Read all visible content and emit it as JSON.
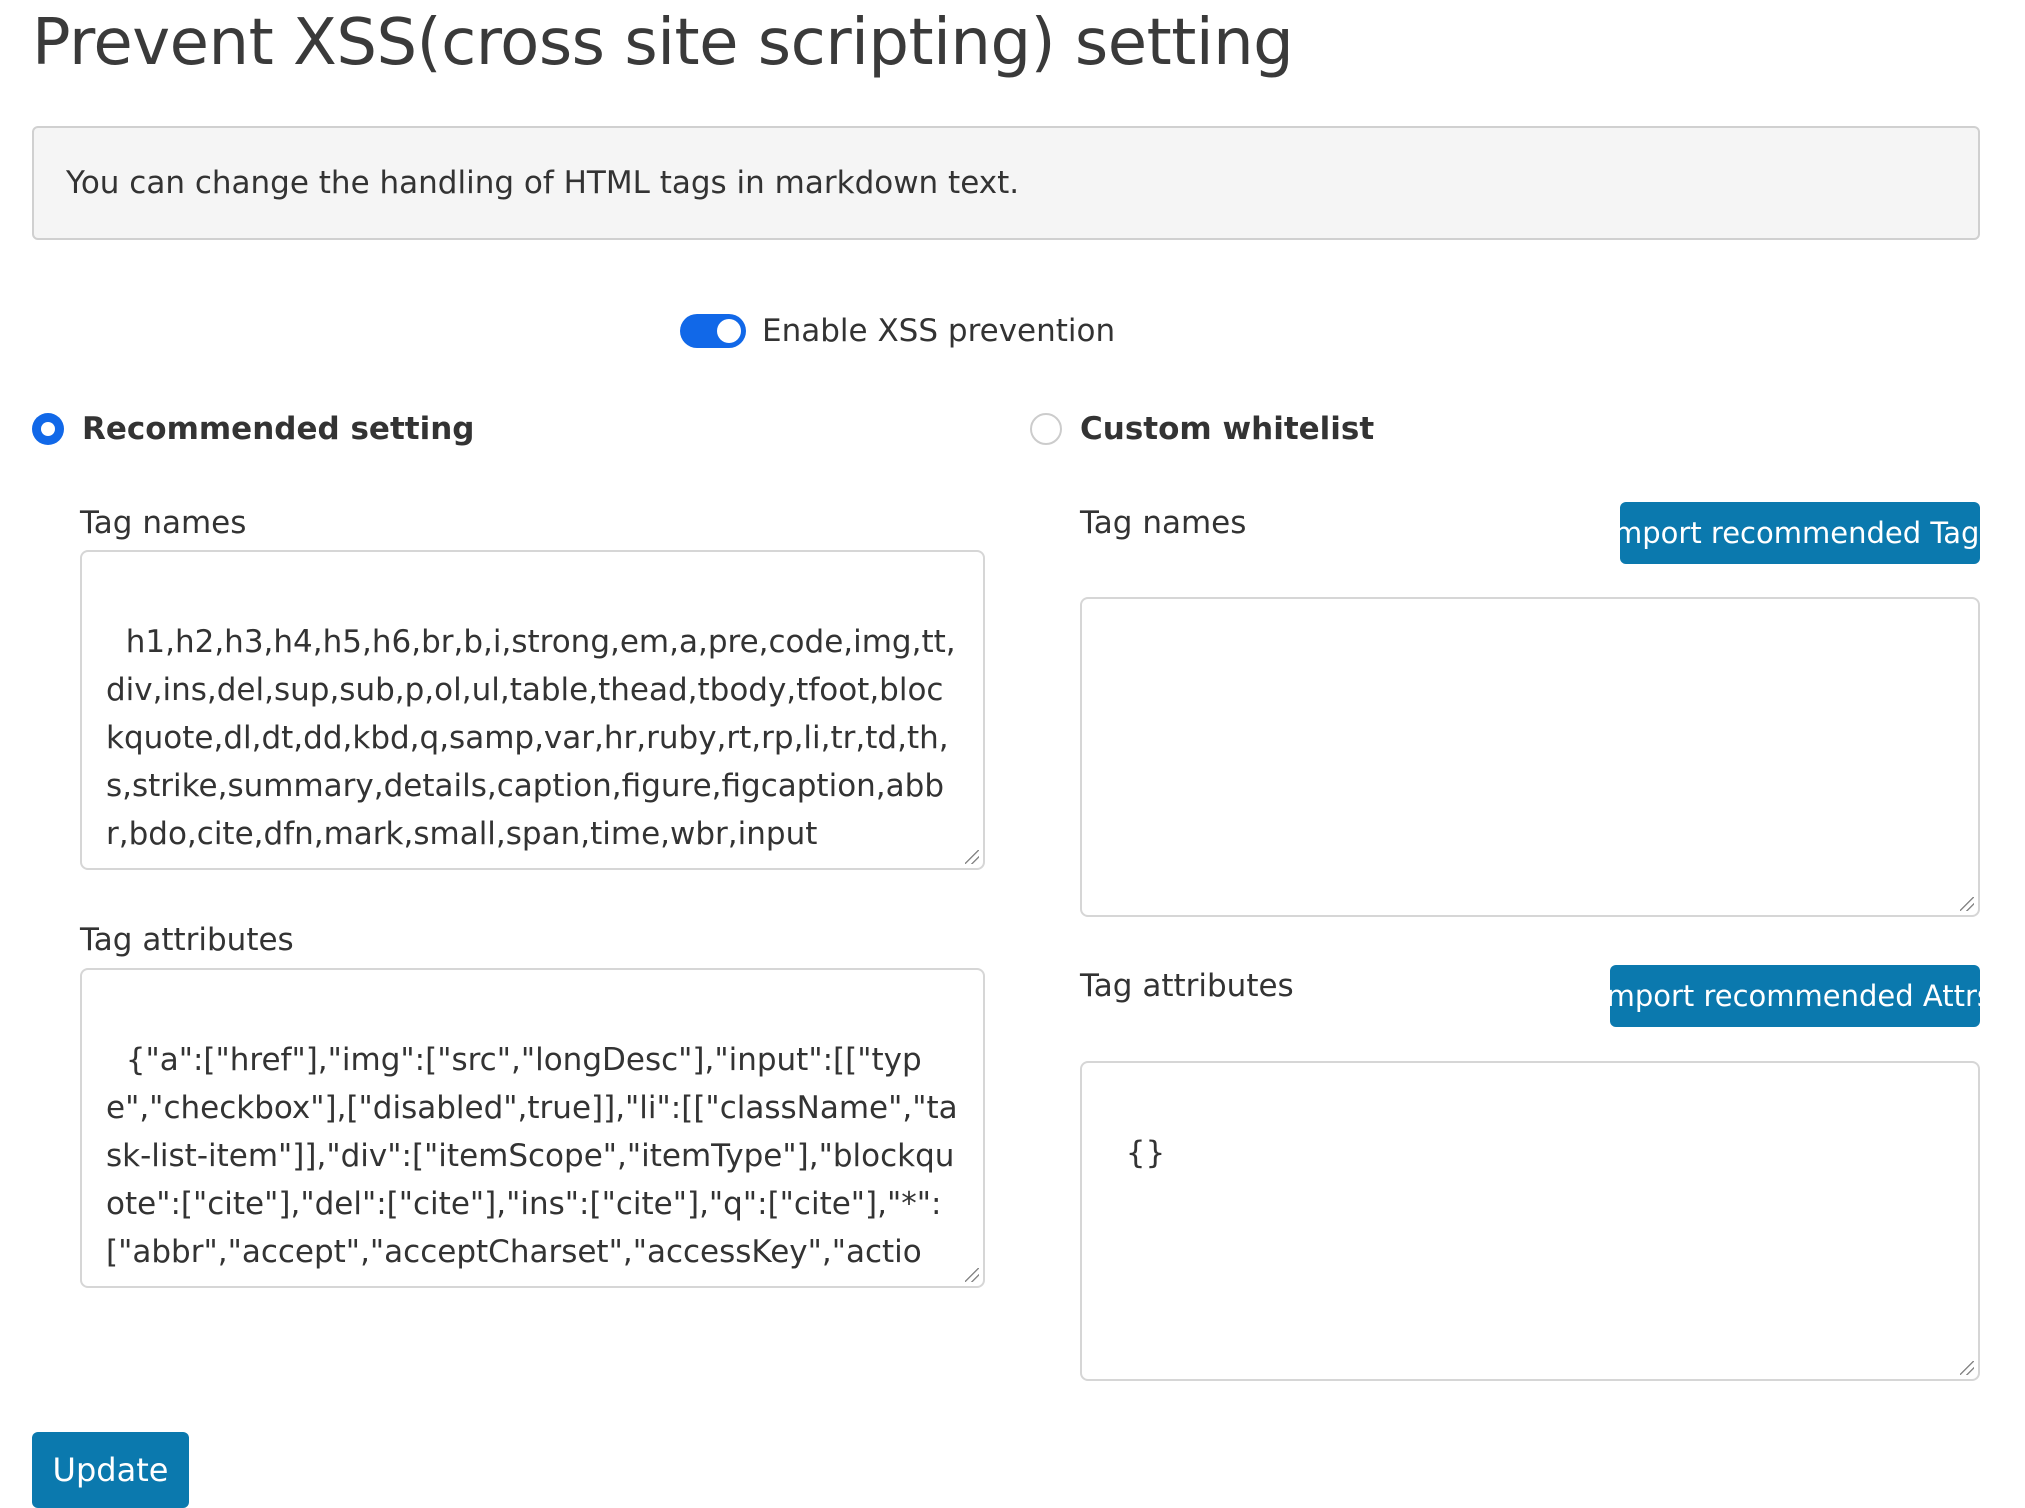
{
  "page": {
    "title": "Prevent XSS(cross site scripting) setting",
    "description": "You can change the handling of HTML tags in markdown text."
  },
  "toggle": {
    "label": "Enable XSS prevention",
    "enabled": true
  },
  "recommended": {
    "radio_label": "Recommended setting",
    "selected": true,
    "tag_names_label": "Tag names",
    "tag_names_value": "h1,h2,h3,h4,h5,h6,br,b,i,strong,em,a,pre,code,img,tt,div,ins,del,sup,sub,p,ol,ul,table,thead,tbody,tfoot,blockquote,dl,dt,dd,kbd,q,samp,var,hr,ruby,rt,rp,li,tr,td,th,s,strike,summary,details,caption,figure,figcaption,abbr,bdo,cite,dfn,mark,small,span,time,wbr,input",
    "tag_attributes_label": "Tag attributes",
    "tag_attributes_value": "{\"a\":[\"href\"],\"img\":[\"src\",\"longDesc\"],\"input\":[[\"type\",\"checkbox\"],[\"disabled\",true]],\"li\":[[\"className\",\"task-list-item\"]],\"div\":[\"itemScope\",\"itemType\"],\"blockquote\":[\"cite\"],\"del\":[\"cite\"],\"ins\":[\"cite\"],\"q\":[\"cite\"],\"*\":[\"abbr\",\"accept\",\"acceptCharset\",\"accessKey\",\"action\",\"align\",\"alt\",\"ariaDescribedBy\",\"ariaHidden\",\"ariaLabel\",\"ariaLabelledB"
  },
  "custom": {
    "radio_label": "Custom whitelist",
    "selected": false,
    "tag_names_label": "Tag names",
    "import_tags_label": "Import recommended Tags",
    "tag_names_value": "",
    "tag_attributes_label": "Tag attributes",
    "import_attrs_label": "Import recommended Attrs",
    "tag_attributes_value": "{}"
  },
  "actions": {
    "update_label": "Update"
  },
  "colors": {
    "accent": "#1168e8",
    "button": "#0b79ae"
  }
}
